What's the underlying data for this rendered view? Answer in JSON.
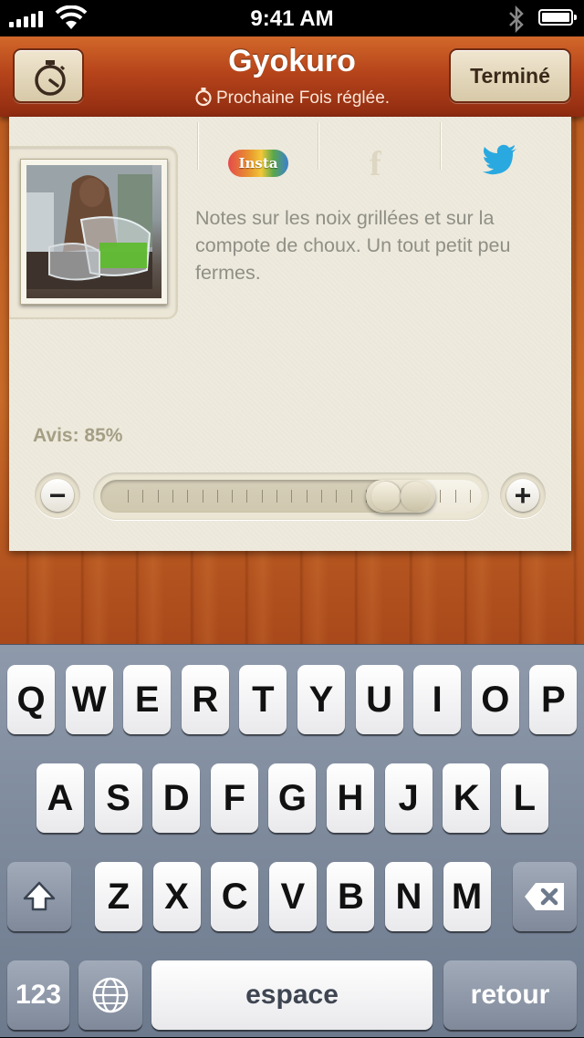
{
  "status_bar": {
    "time": "9:41 AM"
  },
  "header": {
    "title": "Gyokuro",
    "subtitle": "Prochaine Fois réglée.",
    "done_label": "Terminé"
  },
  "share": {
    "instagram_label": "Insta",
    "facebook_label": "f"
  },
  "notes": "Notes sur les noix grillées et sur la compote de choux. Un tout petit peu fermes.",
  "rating": {
    "label": "Avis: 85%",
    "value": 85
  },
  "keyboard": {
    "row1": [
      "Q",
      "W",
      "E",
      "R",
      "T",
      "Y",
      "U",
      "I",
      "O",
      "P"
    ],
    "row2": [
      "A",
      "S",
      "D",
      "F",
      "G",
      "H",
      "J",
      "K",
      "L"
    ],
    "row3": [
      "Z",
      "X",
      "C",
      "V",
      "B",
      "N",
      "M"
    ],
    "numbers_label": "123",
    "space_label": "espace",
    "return_label": "retour"
  },
  "colors": {
    "nav_accent": "#b6441b",
    "card_bg": "#eeeadd",
    "twitter_blue": "#2aa9e0"
  }
}
